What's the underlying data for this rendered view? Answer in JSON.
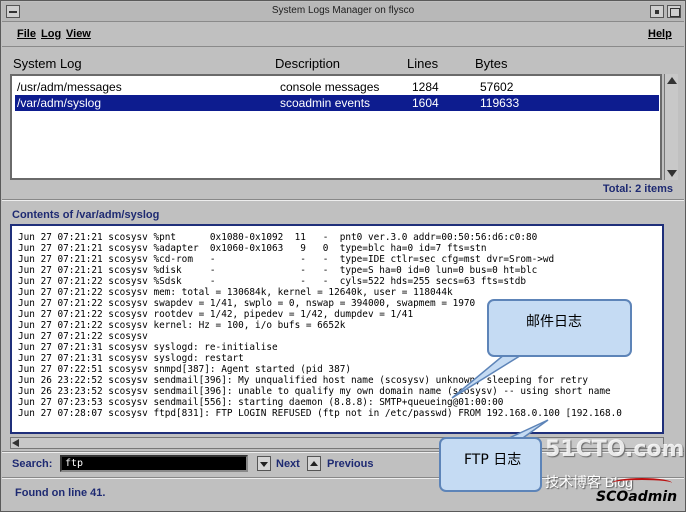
{
  "window": {
    "title": "System Logs Manager on flysco"
  },
  "menu": {
    "file": "File",
    "log": "Log",
    "view": "View",
    "help": "Help"
  },
  "list": {
    "headers": {
      "system_log": "System Log",
      "description": "Description",
      "lines": "Lines",
      "bytes": "Bytes"
    },
    "rows": [
      {
        "path": "/usr/adm/messages",
        "description": "console messages",
        "lines": "1284",
        "bytes": "57602",
        "selected": false
      },
      {
        "path": "/var/adm/syslog",
        "description": "scoadmin events",
        "lines": "1604",
        "bytes": "119633",
        "selected": true
      }
    ],
    "total": "Total: 2 items"
  },
  "contents": {
    "label": "Contents of /var/adm/syslog",
    "lines": [
      "Jun 27 07:21:21 scosysv %pnt      0x1080-0x1092  11   -  pnt0 ver.3.0 addr=00:50:56:d6:c0:80",
      "Jun 27 07:21:21 scosysv %adapter  0x1060-0x1063   9   0  type=blc ha=0 id=7 fts=stn",
      "Jun 27 07:21:21 scosysv %cd-rom   -               -   -  type=IDE ctlr=sec cfg=mst dvr=Srom->wd",
      "Jun 27 07:21:21 scosysv %disk     -               -   -  type=S ha=0 id=0 lun=0 bus=0 ht=blc",
      "Jun 27 07:21:22 scosysv %Sdsk     -               -   -  cyls=522 hds=255 secs=63 fts=stdb",
      "Jun 27 07:21:22 scosysv mem: total = 130684k, kernel = 12640k, user = 118044k",
      "Jun 27 07:21:22 scosysv swapdev = 1/41, swplo = 0, nswap = 394000, swapmem = 1970",
      "Jun 27 07:21:22 scosysv rootdev = 1/42, pipedev = 1/42, dumpdev = 1/41",
      "Jun 27 07:21:22 scosysv kernel: Hz = 100, i/o bufs = 6652k",
      "Jun 27 07:21:22 scosysv",
      "Jun 27 07:21:31 scosysv syslogd: re-initialise",
      "Jun 27 07:21:31 scosysv syslogd: restart",
      "Jun 27 07:22:51 scosysv snmpd[387]: Agent started (pid 387)",
      "Jun 26 23:22:52 scosysv sendmail[396]: My unqualified host name (scosysv) unknown; sleeping for retry",
      "Jun 26 23:23:52 scosysv sendmail[396]: unable to qualify my own domain name (scosysv) -- using short name",
      "Jun 27 07:23:53 scosysv sendmail[556]: starting daemon (8.8.8): SMTP+queueing@01:00:00",
      "Jun 27 07:28:07 scosysv ftpd[831]: FTP LOGIN REFUSED (ftp not in /etc/passwd) FROM 192.168.0.100 [192.168.0"
    ]
  },
  "search": {
    "label": "Search:",
    "value": "ftp",
    "next": "Next",
    "previous": "Previous"
  },
  "status": "Found on line 41.",
  "callouts": {
    "mail": "邮件日志",
    "ftp": "FTP 日志"
  },
  "watermark": {
    "site": "51CTO.com",
    "slogan": "技术博客  Blog",
    "brand": "SCOadmin"
  }
}
